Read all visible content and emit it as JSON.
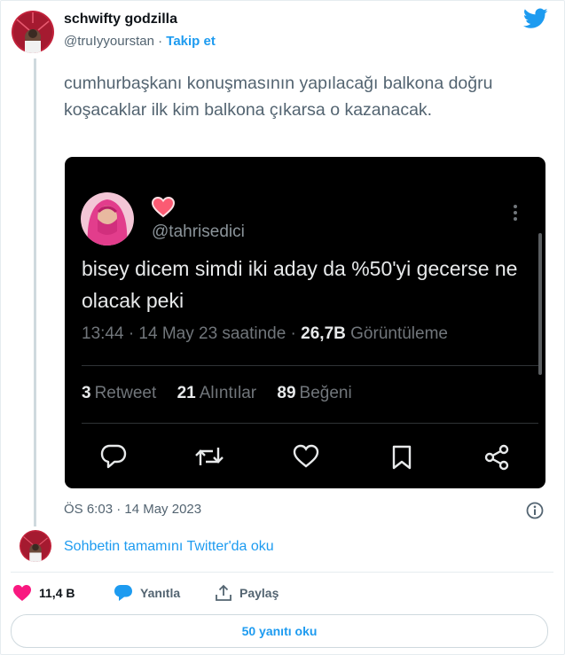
{
  "author": {
    "display_name": "schwifty godzilla",
    "handle": "@truIyyourstan",
    "separator": "·",
    "follow_label": "Takip et"
  },
  "tweet": {
    "text": "cumhurbaşkanı konuşmasının yapılacağı balkona doğru koşacaklar ilk kim balkona çıkarsa o kazanacak.",
    "timestamp": "ÖS 6:03 · 14 May 2023"
  },
  "embedded_tweet": {
    "handle": "@tahrisedici",
    "text": "bisey dicem simdi iki aday da %50'yi gecerse ne olacak peki",
    "time": "13:44 · 14 May 23 saatinde ·",
    "views_count": "26,7B",
    "views_label": "Görüntüleme",
    "retweets_count": "3",
    "retweets_label": "Retweet",
    "quotes_count": "21",
    "quotes_label": "Alıntılar",
    "likes_count": "89",
    "likes_label": "Beğeni",
    "actions": [
      "reply-icon",
      "retweet-icon",
      "like-icon",
      "bookmark-icon",
      "share-icon"
    ]
  },
  "conversation_link": "Sohbetin tamamını Twitter'da oku",
  "actions": {
    "like_count": "11,4 B",
    "reply_label": "Yanıtla",
    "share_label": "Paylaş"
  },
  "replies_button": "50 yanıtı oku",
  "colors": {
    "twitter_blue": "#1d9bf0",
    "like_pink": "#f91880",
    "secondary_text": "#536471",
    "embed_background": "#000000"
  }
}
